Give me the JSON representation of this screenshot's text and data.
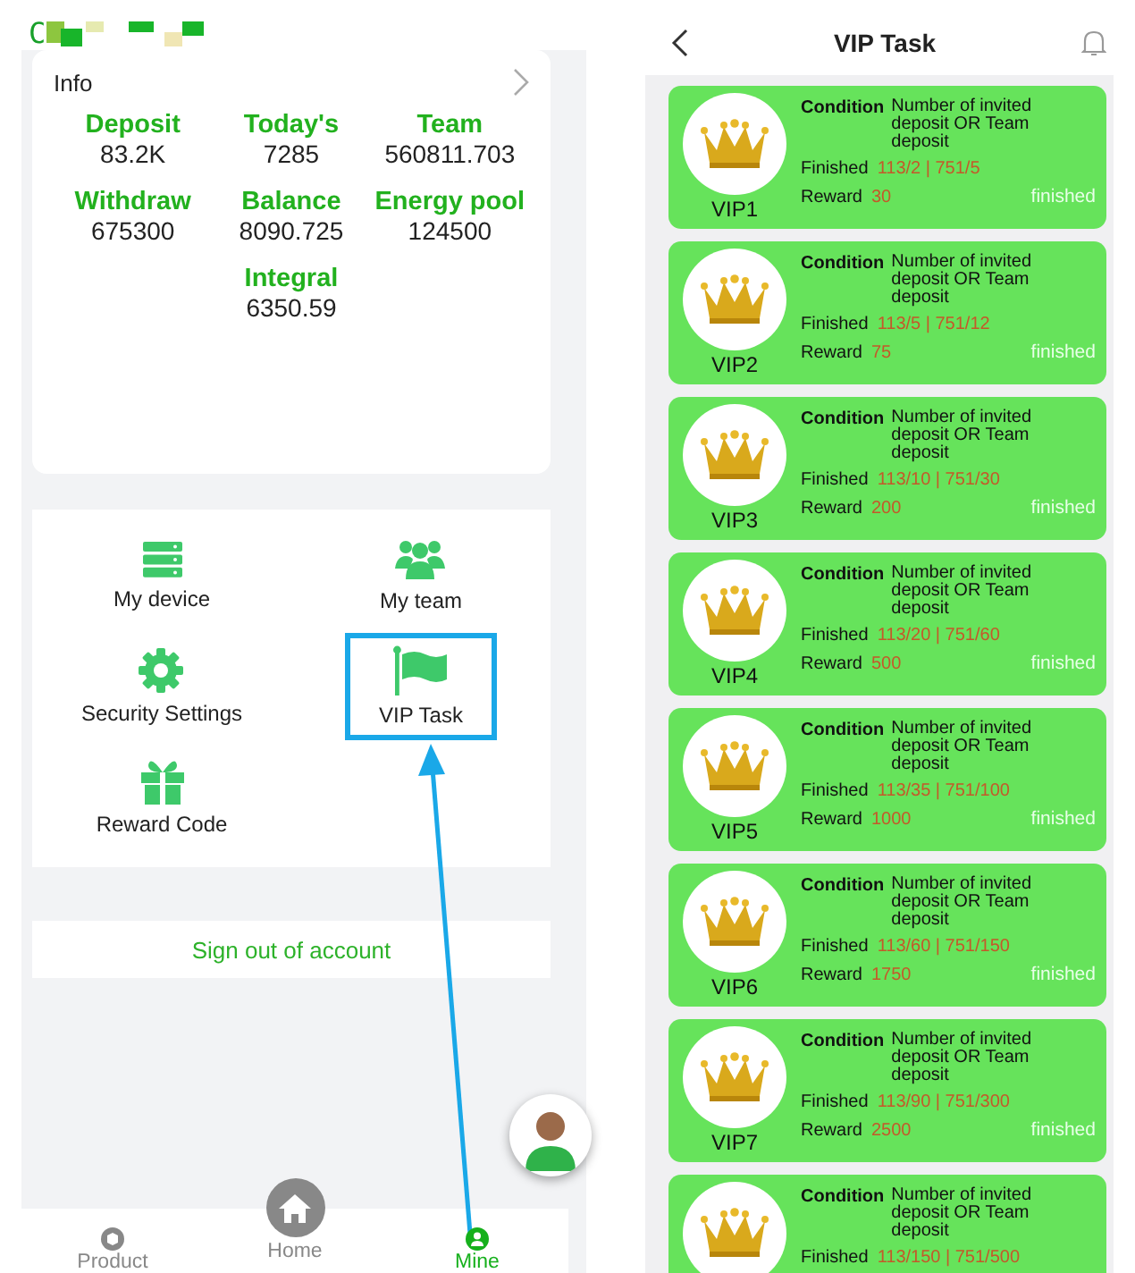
{
  "mine_screen": {
    "user_name": "C",
    "info": {
      "title": "Info",
      "stats": [
        {
          "label": "Deposit",
          "value": "83.2K"
        },
        {
          "label": "Today's",
          "value": "7285"
        },
        {
          "label": "Team",
          "value": "560811.703"
        },
        {
          "label": "Withdraw",
          "value": "675300"
        },
        {
          "label": "Balance",
          "value": "8090.725"
        },
        {
          "label": "Energy pool",
          "value": "124500"
        },
        {
          "label": "Integral",
          "value": "6350.59"
        }
      ]
    },
    "menu": [
      {
        "label": "My device",
        "highlighted": false
      },
      {
        "label": "My team",
        "highlighted": false
      },
      {
        "label": "Security Settings",
        "highlighted": false
      },
      {
        "label": "VIP Task",
        "highlighted": true
      },
      {
        "label": "Reward Code",
        "highlighted": false
      }
    ],
    "sign_out": "Sign out of account",
    "nav": [
      {
        "label": "Product",
        "kind": "tab",
        "selected": false
      },
      {
        "label": "Home",
        "kind": "raised",
        "selected": false
      },
      {
        "label": "Mine",
        "kind": "tab",
        "selected": true
      }
    ]
  },
  "vip_screen": {
    "title": "VIP Task",
    "cards": [
      {
        "vip": "VIP1",
        "condition_label": "Condition",
        "condition": "Number of invited deposit OR Team deposit",
        "finished_label": "Finished",
        "finished": "113/2 | 751/5",
        "reward_label": "Reward",
        "reward": "30",
        "status": "finished"
      },
      {
        "vip": "VIP2",
        "condition_label": "Condition",
        "condition": "Number of invited deposit OR Team deposit",
        "finished_label": "Finished",
        "finished": "113/5 | 751/12",
        "reward_label": "Reward",
        "reward": "75",
        "status": "finished"
      },
      {
        "vip": "VIP3",
        "condition_label": "Condition",
        "condition": "Number of invited deposit OR Team deposit",
        "finished_label": "Finished",
        "finished": "113/10 | 751/30",
        "reward_label": "Reward",
        "reward": "200",
        "status": "finished"
      },
      {
        "vip": "VIP4",
        "condition_label": "Condition",
        "condition": "Number of invited deposit OR Team deposit",
        "finished_label": "Finished",
        "finished": "113/20 | 751/60",
        "reward_label": "Reward",
        "reward": "500",
        "status": "finished"
      },
      {
        "vip": "VIP5",
        "condition_label": "Condition",
        "condition": "Number of invited deposit OR Team deposit",
        "finished_label": "Finished",
        "finished": "113/35 | 751/100",
        "reward_label": "Reward",
        "reward": "1000",
        "status": "finished"
      },
      {
        "vip": "VIP6",
        "condition_label": "Condition",
        "condition": "Number of invited deposit OR Team deposit",
        "finished_label": "Finished",
        "finished": "113/60 | 751/150",
        "reward_label": "Reward",
        "reward": "1750",
        "status": "finished"
      },
      {
        "vip": "VIP7",
        "condition_label": "Condition",
        "condition": "Number of invited deposit OR Team deposit",
        "finished_label": "Finished",
        "finished": "113/90 | 751/300",
        "reward_label": "Reward",
        "reward": "2500",
        "status": "finished"
      },
      {
        "condition_label": "Condition",
        "condition": "Number of invited deposit OR Team deposit",
        "finished_label": "Finished",
        "finished": "113/150 | 751/500"
      }
    ]
  }
}
